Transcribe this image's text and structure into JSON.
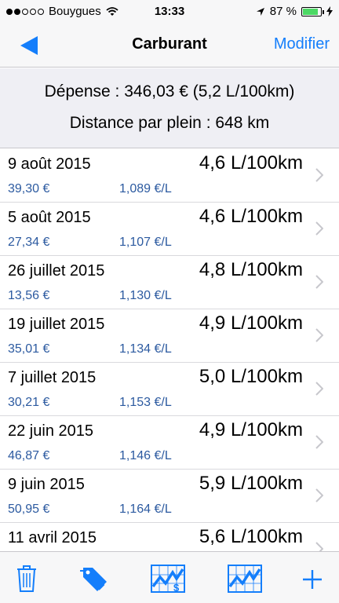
{
  "status_bar": {
    "carrier": "Bouygues",
    "time": "13:33",
    "battery": "87 %"
  },
  "nav": {
    "title": "Carburant",
    "edit_label": "Modifier"
  },
  "summary": {
    "expense": "Dépense : 346,03 €  (5,2 L/100km)",
    "distance": "Distance par plein : 648 km"
  },
  "entries": [
    {
      "date": "9 août 2015",
      "consumption": "4,6 L/100km",
      "amount": "39,30 €",
      "unit_price": "1,089 €/L"
    },
    {
      "date": "5 août 2015",
      "consumption": "4,6 L/100km",
      "amount": "27,34 €",
      "unit_price": "1,107 €/L"
    },
    {
      "date": "26 juillet 2015",
      "consumption": "4,8 L/100km",
      "amount": "13,56 €",
      "unit_price": "1,130 €/L"
    },
    {
      "date": "19 juillet 2015",
      "consumption": "4,9 L/100km",
      "amount": "35,01 €",
      "unit_price": "1,134 €/L"
    },
    {
      "date": "7 juillet 2015",
      "consumption": "5,0 L/100km",
      "amount": "30,21 €",
      "unit_price": "1,153 €/L"
    },
    {
      "date": "22 juin 2015",
      "consumption": "4,9 L/100km",
      "amount": "46,87 €",
      "unit_price": "1,146 €/L"
    },
    {
      "date": "9 juin 2015",
      "consumption": "5,9 L/100km",
      "amount": "50,95 €",
      "unit_price": "1,164 €/L"
    },
    {
      "date": "11 avril 2015",
      "consumption": "5,6 L/100km",
      "amount": "",
      "unit_price": ""
    }
  ],
  "toolbar": {
    "icons": [
      "trash-icon",
      "tags-icon",
      "cost-chart-icon",
      "consumption-chart-icon",
      "plus-icon"
    ],
    "accent": "#147efb"
  }
}
